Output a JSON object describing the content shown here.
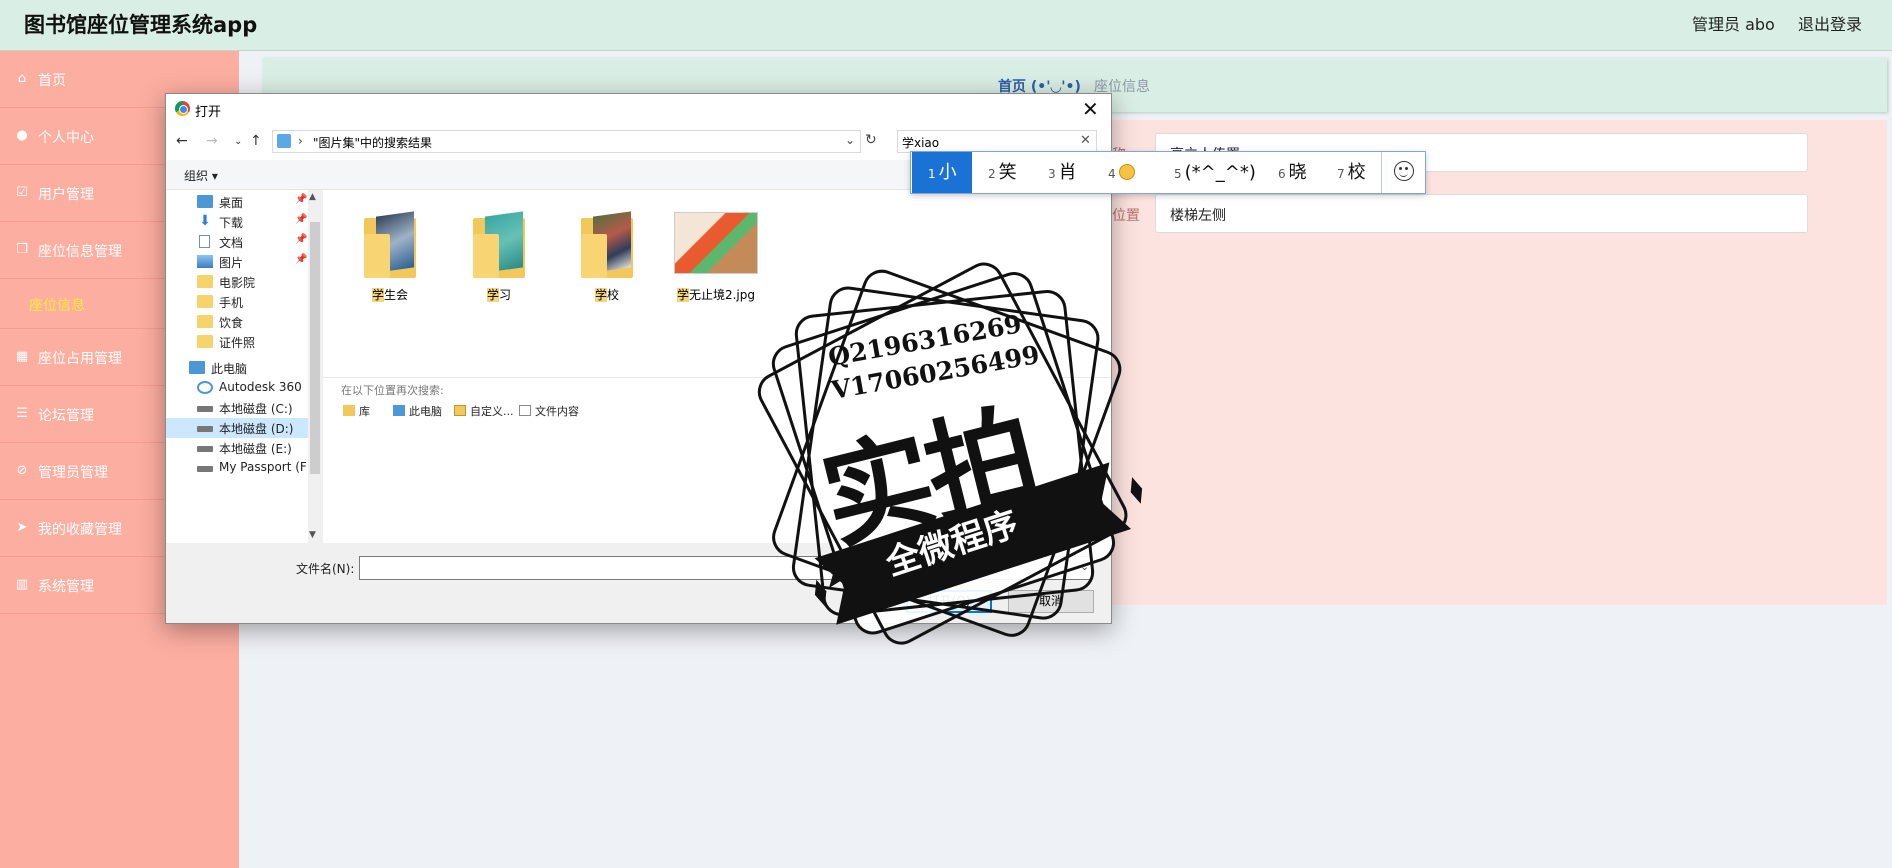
{
  "app": {
    "title": "图书馆座位管理系统app",
    "user": "管理员 abo",
    "logout": "退出登录"
  },
  "sidebar": {
    "items": [
      {
        "label": "首页",
        "icon": "home-icon"
      },
      {
        "label": "个人中心",
        "icon": "user-icon"
      },
      {
        "label": "用户管理",
        "icon": "check-square-icon"
      },
      {
        "label": "座位信息管理",
        "icon": "copy-icon"
      },
      {
        "label": "座位信息",
        "icon": ""
      },
      {
        "label": "座位占用管理",
        "icon": "grid-icon"
      },
      {
        "label": "论坛管理",
        "icon": "list-icon"
      },
      {
        "label": "管理员管理",
        "icon": "bell-slash-icon"
      },
      {
        "label": "我的收藏管理",
        "icon": "send-icon"
      },
      {
        "label": "系统管理",
        "icon": "columns-icon"
      }
    ]
  },
  "breadcrumb": {
    "home": "首页",
    "face": "(•'◡'•)",
    "current": "座位信息"
  },
  "form": {
    "field1_label": "名称",
    "field1_value": "亮立人传署",
    "field2_label": "座位置",
    "field2_value": "楼梯左侧"
  },
  "dialog": {
    "title": "打开",
    "address": "\"图片集\"中的搜索结果",
    "search_value": "学xiao",
    "organize": "组织 ▾",
    "tree": [
      {
        "label": "桌面",
        "type": "pc",
        "pinned": true
      },
      {
        "label": "下载",
        "type": "pc",
        "pinned": true
      },
      {
        "label": "文档",
        "type": "doc",
        "pinned": true
      },
      {
        "label": "图片",
        "type": "pc",
        "pinned": true
      },
      {
        "label": "电影院",
        "type": "folder",
        "pinned": false
      },
      {
        "label": "手机",
        "type": "folder",
        "pinned": false
      },
      {
        "label": "饮食",
        "type": "folder",
        "pinned": false
      },
      {
        "label": "证件照",
        "type": "folder",
        "pinned": false
      },
      {
        "label": "此电脑",
        "type": "pc",
        "pinned": false
      },
      {
        "label": "Autodesk 360",
        "type": "cloud",
        "pinned": false
      },
      {
        "label": "本地磁盘 (C:)",
        "type": "disk",
        "pinned": false
      },
      {
        "label": "本地磁盘 (D:)",
        "type": "disk",
        "pinned": false
      },
      {
        "label": "本地磁盘 (E:)",
        "type": "disk",
        "pinned": false
      },
      {
        "label": "My Passport (F",
        "type": "disk",
        "pinned": false
      }
    ],
    "files": [
      {
        "hl": "学",
        "rest": "生会",
        "type": "folder"
      },
      {
        "hl": "学",
        "rest": "习",
        "type": "folder"
      },
      {
        "hl": "学",
        "rest": "校",
        "type": "folder"
      },
      {
        "hl": "学",
        "rest": "无止境2.jpg",
        "type": "image"
      }
    ],
    "research_title": "在以下位置再次搜索:",
    "research_links": [
      "库",
      "此电脑",
      "自定义...",
      "文件内容"
    ],
    "filename_label": "文件名(N):",
    "filename_value": "",
    "open_button": "打开(O)",
    "cancel_button": "取消"
  },
  "ime": {
    "candidates": [
      {
        "n": "1",
        "text": "小"
      },
      {
        "n": "2",
        "text": "笑"
      },
      {
        "n": "3",
        "text": "肖"
      },
      {
        "n": "4",
        "text": ""
      },
      {
        "n": "5",
        "text": "(*^_^*)"
      },
      {
        "n": "6",
        "text": "晓"
      },
      {
        "n": "7",
        "text": "校"
      }
    ]
  },
  "watermark": {
    "line1": "Q2196316269",
    "line2": "V17060256499",
    "main": "实拍",
    "banner": "全微程序"
  }
}
